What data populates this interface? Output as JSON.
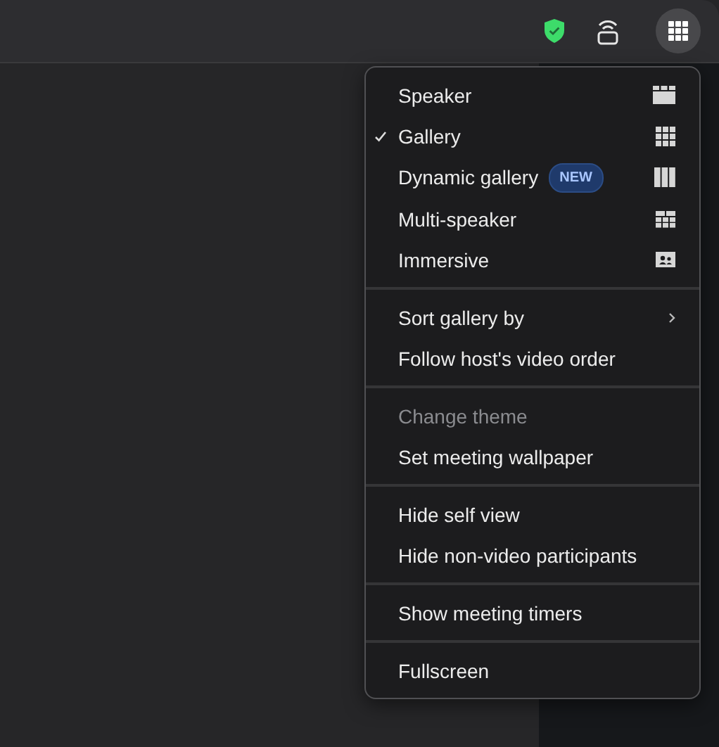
{
  "menu": {
    "sections": [
      {
        "items": [
          {
            "label": "Speaker",
            "kind": "speaker",
            "selected": false,
            "disabled": false
          },
          {
            "label": "Gallery",
            "kind": "gallery",
            "selected": true,
            "disabled": false
          },
          {
            "label": "Dynamic gallery",
            "kind": "dynamic",
            "badge": "NEW",
            "selected": false,
            "disabled": false
          },
          {
            "label": "Multi-speaker",
            "kind": "multi",
            "selected": false,
            "disabled": false
          },
          {
            "label": "Immersive",
            "kind": "immersive",
            "selected": false,
            "disabled": false
          }
        ]
      },
      {
        "items": [
          {
            "label": "Sort gallery by",
            "kind": "submenu",
            "disabled": false
          },
          {
            "label": "Follow host's video order",
            "kind": "plain",
            "disabled": false
          }
        ]
      },
      {
        "items": [
          {
            "label": "Change theme",
            "kind": "plain",
            "disabled": true
          },
          {
            "label": "Set meeting wallpaper",
            "kind": "plain",
            "disabled": false
          }
        ]
      },
      {
        "items": [
          {
            "label": "Hide self view",
            "kind": "plain",
            "disabled": false
          },
          {
            "label": "Hide non-video participants",
            "kind": "plain",
            "disabled": false
          }
        ]
      },
      {
        "items": [
          {
            "label": "Show meeting timers",
            "kind": "plain",
            "disabled": false
          }
        ]
      },
      {
        "items": [
          {
            "label": "Fullscreen",
            "kind": "plain",
            "disabled": false
          }
        ]
      }
    ]
  }
}
